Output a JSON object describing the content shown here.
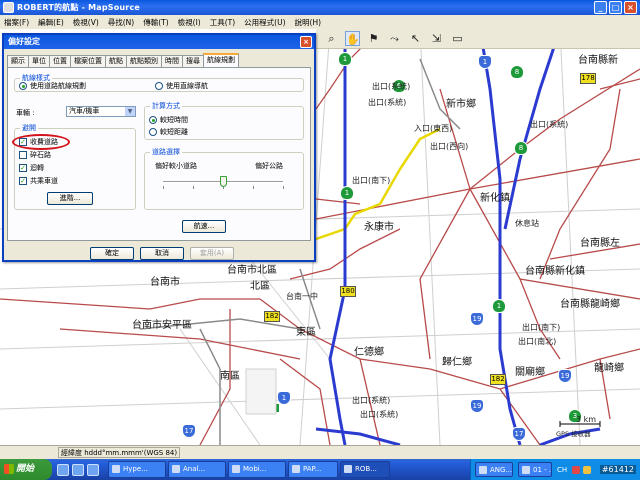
{
  "window": {
    "title": "ROBERT的航點 - MapSource",
    "controls": [
      "_",
      "□",
      "×"
    ]
  },
  "menu": [
    "檔案(F)",
    "編輯(E)",
    "檢視(V)",
    "尋找(N)",
    "傳輸(T)",
    "檢視(I)",
    "工具(T)",
    "公用程式(U)",
    "說明(H)"
  ],
  "toolbar_icons": [
    "zoom-icon",
    "hand-icon",
    "flag-icon",
    "route-icon",
    "pointer-icon",
    "distance-icon",
    "gps-icon"
  ],
  "map": {
    "labels": [
      {
        "text": "台南縣新",
        "cls": "big"
      },
      {
        "text": "出口(系統)",
        "cls": ""
      },
      {
        "text": "新市鄉",
        "cls": "big"
      },
      {
        "text": "出口(系統)",
        "cls": ""
      },
      {
        "text": "入口(東西)",
        "cls": ""
      },
      {
        "text": "出口(系統)",
        "cls": ""
      },
      {
        "text": "出口(西向)",
        "cls": ""
      },
      {
        "text": "出口(南下)",
        "cls": ""
      },
      {
        "text": "新化鎮",
        "cls": "big"
      },
      {
        "text": "永康市",
        "cls": "big"
      },
      {
        "text": "休息站",
        "cls": ""
      },
      {
        "text": "台南縣左",
        "cls": "big"
      },
      {
        "text": "台南縣新化鎮",
        "cls": "big"
      },
      {
        "text": "台南市",
        "cls": "big"
      },
      {
        "text": "台南市北區",
        "cls": "big"
      },
      {
        "text": "北區",
        "cls": "big"
      },
      {
        "text": "台南一中",
        "cls": ""
      },
      {
        "text": "台南縣龍崎鄉",
        "cls": "big"
      },
      {
        "text": "台南市安平區",
        "cls": "big"
      },
      {
        "text": "東區",
        "cls": "big"
      },
      {
        "text": "出口(南下)",
        "cls": ""
      },
      {
        "text": "出口(南北)",
        "cls": ""
      },
      {
        "text": "仁德鄉",
        "cls": "big"
      },
      {
        "text": "歸仁鄉",
        "cls": "big"
      },
      {
        "text": "關廟鄉",
        "cls": "big"
      },
      {
        "text": "龍崎鄉",
        "cls": "big"
      },
      {
        "text": "南區",
        "cls": "big"
      },
      {
        "text": "出口(系統)",
        "cls": ""
      },
      {
        "text": "出口(系統)",
        "cls": ""
      },
      {
        "text": "3 km",
        "cls": ""
      },
      {
        "text": "GPS 接收器",
        "cls": ""
      }
    ],
    "shields": [
      {
        "num": "1"
      },
      {
        "num": "6"
      },
      {
        "num": "8"
      },
      {
        "num": "1"
      },
      {
        "num": "8"
      },
      {
        "num": "1"
      },
      {
        "num": "19"
      },
      {
        "num": "1"
      },
      {
        "num": "3"
      },
      {
        "num": "1"
      },
      {
        "num": "19"
      },
      {
        "num": "17"
      },
      {
        "num": "17"
      },
      {
        "num": "19"
      }
    ],
    "route_badges": [
      {
        "num": "178"
      },
      {
        "num": "180"
      },
      {
        "num": "182"
      },
      {
        "num": "182"
      }
    ]
  },
  "dialog": {
    "title": "偏好設定",
    "close": "×",
    "tabs": [
      "顯示",
      "單位",
      "位置",
      "檔案位置",
      "航點",
      "航點類別",
      "時間",
      "搜尋",
      "航線規劃"
    ],
    "active_tab": "航線規劃",
    "group_style": {
      "label": "航線樣式",
      "opt1": "使用道路航線規劃",
      "opt2": "使用直線導航"
    },
    "vehicle": {
      "label": "車輛 :",
      "value": "汽車/機車"
    },
    "group_calc": {
      "label": "計算方式",
      "opt1": "較短時間",
      "opt2": "較短距離"
    },
    "group_avoid": {
      "label": "避開",
      "items": [
        {
          "label": "收費道路",
          "checked": true
        },
        {
          "label": "碎石路",
          "checked": false
        },
        {
          "label": "迴轉",
          "checked": true
        },
        {
          "label": "共乘車道",
          "checked": true
        }
      ],
      "advanced": "進階..."
    },
    "group_road": {
      "label": "道路選擇",
      "left": "偏好較小道路",
      "right": "偏好公路",
      "level": 0.5
    },
    "fast_btn": "航速...",
    "ok": "確定",
    "cancel": "取消",
    "apply": "套用(A)"
  },
  "status": {
    "coord": "經緯度 hddd°mm.mmm'(WGS 84)"
  },
  "taskbar": {
    "start": "開始",
    "tasks": [
      "Hype...",
      "Anal...",
      "Mobi...",
      "PAP...",
      "ROB...",
      "ANG...",
      "01 - ..."
    ],
    "lang": "CH",
    "clock": "#61412"
  },
  "colors": {
    "highway": "#2b3bd0",
    "road": "#b84a4a",
    "major": "#f0e020",
    "shield_green": "#1f9a3a",
    "shield_blue": "#3a6bd8",
    "dialog_title": "#0a58e0",
    "oval": "#d4141c"
  }
}
